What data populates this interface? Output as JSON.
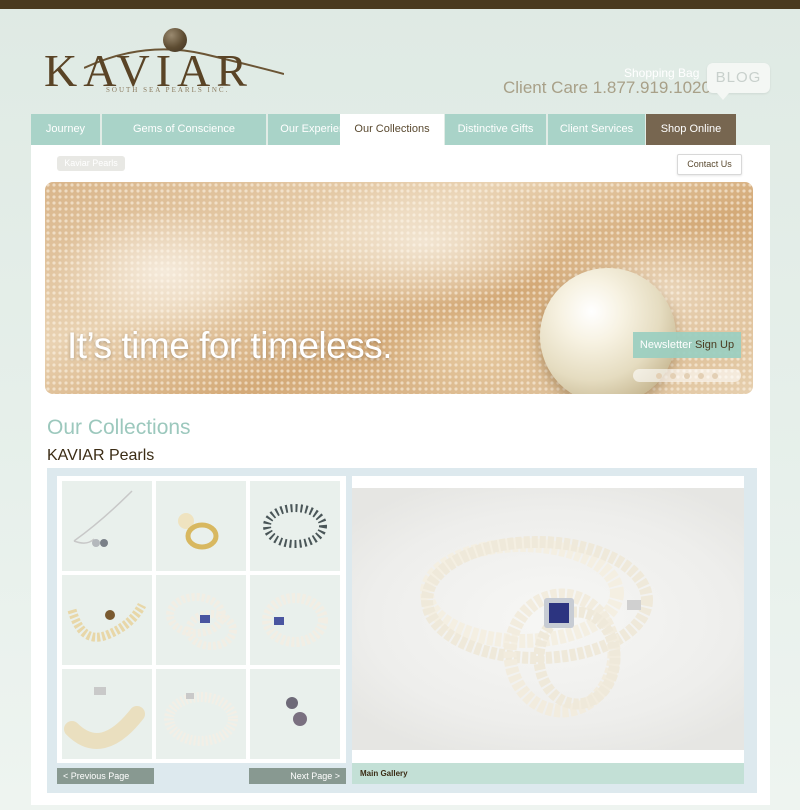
{
  "brand": {
    "name": "KAVIAR",
    "tagline": "SOUTH SEA PEARLS INC."
  },
  "header": {
    "shopping_bag": "Shopping Bag",
    "client_care": "Client Care 1.877.919.1020",
    "blog": "BLOG"
  },
  "nav": {
    "tabs": [
      {
        "label": "Journey",
        "active": false
      },
      {
        "label": "Gems of Conscience",
        "active": false
      },
      {
        "label": "Our Experience",
        "active": false
      },
      {
        "label": "Our Collections",
        "active": true
      },
      {
        "label": "Distinctive Gifts",
        "active": false
      },
      {
        "label": "Client Services",
        "active": false
      },
      {
        "label": "Shop Online",
        "active": false
      }
    ]
  },
  "breadcrumb": "Kaviar Pearls",
  "contact_button": "Contact Us",
  "hero": {
    "headline": "It’s time for timeless.",
    "newsletter_label": "Newsletter",
    "signup_label": "Sign Up",
    "slide_count": 5
  },
  "page": {
    "heading": "Our Collections",
    "subheading": "KAVIAR Pearls"
  },
  "gallery": {
    "prev_label": "< Previous Page",
    "next_label": "Next Page >",
    "caption": "Main Gallery"
  },
  "colors": {
    "top_bar": "#4a3a1f",
    "tab": "#a9d3c8",
    "shop_tab": "#776650",
    "heading": "#9cc8bd",
    "brand_brown": "#5a4426"
  }
}
